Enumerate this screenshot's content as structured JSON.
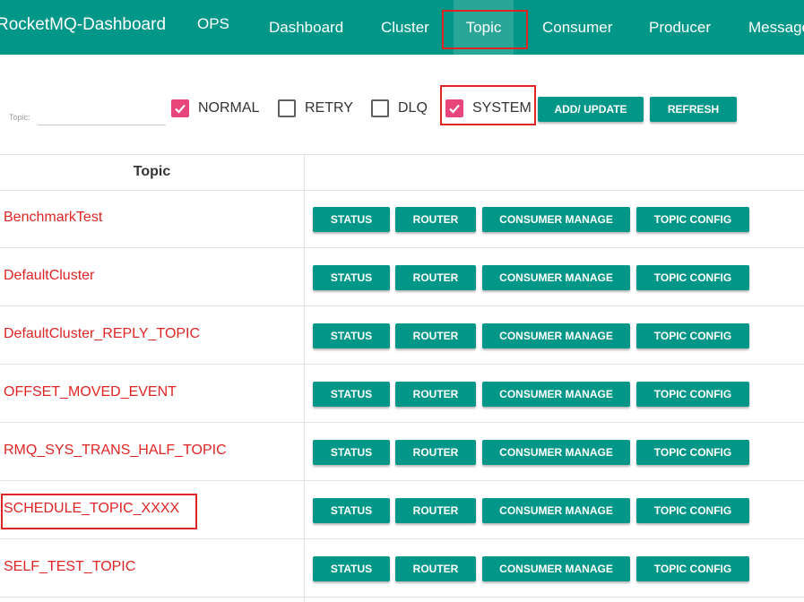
{
  "nav": {
    "brand": "RocketMQ-Dashboard",
    "items": [
      {
        "id": "ops",
        "label": "OPS"
      },
      {
        "id": "dashboard",
        "label": "Dashboard"
      },
      {
        "id": "cluster",
        "label": "Cluster"
      },
      {
        "id": "topic",
        "label": "Topic",
        "active": true
      },
      {
        "id": "consumer",
        "label": "Consumer"
      },
      {
        "id": "producer",
        "label": "Producer"
      },
      {
        "id": "message",
        "label": "Message"
      }
    ],
    "background": "#009688",
    "active_background": "#2aa699"
  },
  "filter": {
    "topic_label": "Topic:",
    "topic_value": "",
    "checkboxes": [
      {
        "id": "normal",
        "label": "NORMAL",
        "checked": true
      },
      {
        "id": "retry",
        "label": "RETRY",
        "checked": false
      },
      {
        "id": "dlq",
        "label": "DLQ",
        "checked": false
      },
      {
        "id": "system",
        "label": "SYSTEM",
        "checked": true
      }
    ],
    "add_update_label": "ADD/ UPDATE",
    "refresh_label": "REFRESH"
  },
  "table": {
    "header_topic": "Topic",
    "action_labels": {
      "status": "STATUS",
      "router": "ROUTER",
      "consumer_manage": "CONSUMER MANAGE",
      "topic_config": "TOPIC CONFIG"
    },
    "rows": [
      {
        "topic": "BenchmarkTest"
      },
      {
        "topic": "DefaultCluster"
      },
      {
        "topic": "DefaultCluster_REPLY_TOPIC"
      },
      {
        "topic": "OFFSET_MOVED_EVENT"
      },
      {
        "topic": "RMQ_SYS_TRANS_HALF_TOPIC"
      },
      {
        "topic": "SCHEDULE_TOPIC_XXXX"
      },
      {
        "topic": "SELF_TEST_TOPIC"
      }
    ]
  },
  "colors": {
    "accent": "#009688",
    "checkbox_checked": "#e8457a",
    "topic_text": "#e02424",
    "annotation": "#e02424"
  }
}
